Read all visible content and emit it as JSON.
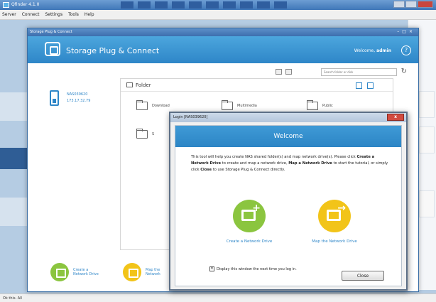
{
  "outer_window": {
    "title": "Qfinder 4.1.0",
    "menu": [
      "Server",
      "Connect",
      "Settings",
      "Tools",
      "Help"
    ],
    "status": "Ok this. All"
  },
  "spc": {
    "caption": "Storage Plug & Connect",
    "title": "Storage Plug & Connect",
    "welcome_prefix": "Welcome,",
    "welcome_user": "admin",
    "help_icon": "?",
    "search_placeholder": "Search folder or disk",
    "refresh_icon": "↻",
    "nas": {
      "name": "NAS039620",
      "ip": "173.17.32.79"
    },
    "folder_header": "Folder",
    "folders": [
      {
        "name": "Download"
      },
      {
        "name": "Multimedia"
      },
      {
        "name": "Public"
      },
      {
        "name": "S"
      }
    ],
    "actions": {
      "create": {
        "line1": "Create a",
        "line2": "Network Drive"
      },
      "map": {
        "line1": "Map the",
        "line2": "Network"
      }
    }
  },
  "login_dialog": {
    "caption": "Login [NAS039620]",
    "close_x": "x",
    "welcome": "Welcome",
    "intro": {
      "p1": "This tool will help you create NAS shared folder(s) and map network drive(s). Please click ",
      "b1": "Create a Network Drive",
      "p2": " to create and map a network drive, ",
      "b2": "Map a Network Drive",
      "p3": " to start the tutorial, or simply click ",
      "b3": "Close",
      "p4": " to use Storage Plug & Connect directly."
    },
    "create_label": "Create a Network Drive",
    "map_label": "Map the Network Drive",
    "checkbox_mark": "✕",
    "checkbox_label": "Display this window the next time you log in.",
    "close_button": "Close"
  }
}
